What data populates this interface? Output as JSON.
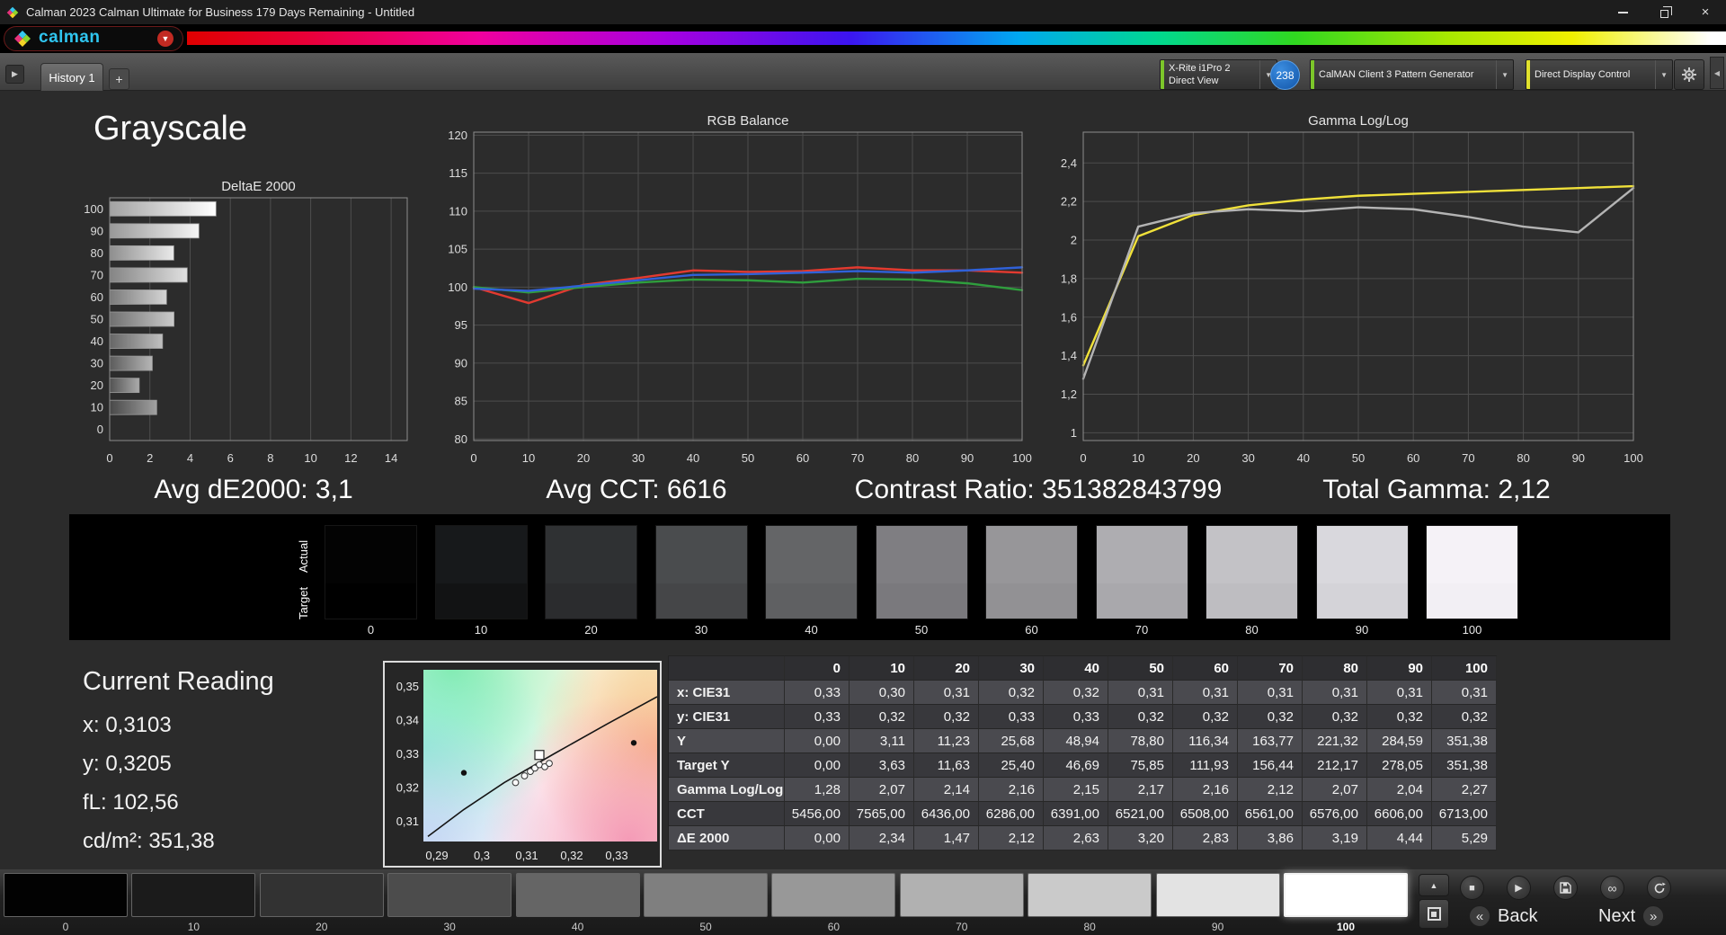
{
  "window": {
    "title": "Calman 2023 Calman Ultimate for Business 179 Days Remaining  - Untitled"
  },
  "brand": {
    "logo_text": "calman"
  },
  "tabs": {
    "history": "History 1",
    "add": "+"
  },
  "toolbar": {
    "meter_line1": "X-Rite i1Pro 2",
    "meter_line2": "Direct View",
    "meter_badge": "238",
    "pattern_generator": "CalMAN Client 3 Pattern Generator",
    "display_control": "Direct Display Control",
    "accent_green": "#7cc62a",
    "accent_yellow": "#e2e22e",
    "badge_blue": "#1b6ec2"
  },
  "page_title": "Grayscale",
  "stats": {
    "avg_de2000": "Avg dE2000: 3,1",
    "avg_cct": "Avg CCT: 6616",
    "contrast_ratio": "Contrast Ratio: 351382843799",
    "total_gamma": "Total Gamma: 2,12"
  },
  "chart_data": [
    {
      "id": "deltae",
      "type": "bar",
      "title": "DeltaE 2000",
      "orientation": "horizontal",
      "categories": [
        100,
        90,
        80,
        70,
        60,
        50,
        40,
        30,
        20,
        10,
        0
      ],
      "values": [
        5.29,
        4.44,
        3.19,
        3.86,
        2.83,
        3.2,
        2.63,
        2.12,
        1.47,
        2.34,
        0
      ],
      "xlim": [
        0,
        14.8
      ],
      "xticks": [
        0,
        2,
        4,
        6,
        8,
        10,
        12,
        14
      ]
    },
    {
      "id": "rgb-balance",
      "type": "line",
      "title": "RGB Balance",
      "x": [
        0,
        10,
        20,
        30,
        40,
        50,
        60,
        70,
        80,
        90,
        100
      ],
      "xticks": [
        0,
        10,
        20,
        30,
        40,
        50,
        60,
        70,
        80,
        90,
        100
      ],
      "xlim": [
        0,
        100
      ],
      "ylim": [
        79.8,
        120.4
      ],
      "yticks": [
        120,
        115,
        110,
        105,
        100,
        95,
        90,
        85,
        80
      ],
      "series": [
        {
          "name": "Red",
          "color": "#e23a30",
          "values": [
            100,
            97.9,
            100.3,
            101.2,
            102.2,
            102.0,
            102.1,
            102.6,
            102.2,
            102.2,
            101.9
          ]
        },
        {
          "name": "Green",
          "color": "#2f9e3d",
          "values": [
            100,
            99.3,
            100.0,
            100.6,
            101.0,
            100.9,
            100.6,
            101.1,
            101.0,
            100.5,
            99.6
          ]
        },
        {
          "name": "Blue",
          "color": "#3061d8",
          "values": [
            99.8,
            99.5,
            100.2,
            100.9,
            101.6,
            101.7,
            101.9,
            102.1,
            101.9,
            102.2,
            102.6
          ]
        }
      ]
    },
    {
      "id": "gamma",
      "type": "line",
      "title": "Gamma Log/Log",
      "x": [
        0,
        10,
        20,
        30,
        40,
        50,
        60,
        70,
        80,
        90,
        100
      ],
      "xticks": [
        0,
        10,
        20,
        30,
        40,
        50,
        60,
        70,
        80,
        90,
        100
      ],
      "xlim": [
        0,
        100
      ],
      "ylim": [
        0.96,
        2.56
      ],
      "yticks": [
        2.4,
        2.2,
        2.0,
        1.8,
        1.6,
        1.4,
        1.2,
        1.0
      ],
      "ytick_labels": [
        "2,4",
        "2,2",
        "2",
        "1,8",
        "1,6",
        "1,4",
        "1,2",
        "1"
      ],
      "series": [
        {
          "name": "Target",
          "color": "#f0e13a",
          "values": [
            1.35,
            2.02,
            2.13,
            2.18,
            2.21,
            2.23,
            2.24,
            2.25,
            2.26,
            2.27,
            2.28
          ]
        },
        {
          "name": "Measured",
          "color": "#b4b4b4",
          "values": [
            1.28,
            2.07,
            2.14,
            2.16,
            2.15,
            2.17,
            2.16,
            2.12,
            2.07,
            2.04,
            2.27
          ]
        }
      ]
    },
    {
      "id": "cie",
      "type": "scatter",
      "title": "CIE chromaticity detail",
      "xlim": [
        0.287,
        0.339
      ],
      "ylim": [
        0.304,
        0.355
      ],
      "xticks": [
        0.29,
        0.3,
        0.31,
        0.32,
        0.33
      ],
      "xtick_labels": [
        "0,29",
        "0,3",
        "0,31",
        "0,32",
        "0,33"
      ],
      "yticks": [
        0.35,
        0.34,
        0.33,
        0.32,
        0.31
      ],
      "ytick_labels": [
        "0,35",
        "0,34",
        "0,33",
        "0,32",
        "0,31"
      ],
      "locus": [
        [
          0.288,
          0.3055
        ],
        [
          0.296,
          0.3135
        ],
        [
          0.305,
          0.3215
        ],
        [
          0.316,
          0.33
        ],
        [
          0.328,
          0.339
        ],
        [
          0.339,
          0.347
        ]
      ],
      "measured_points": [
        [
          0.3075,
          0.3215
        ],
        [
          0.3095,
          0.3235
        ],
        [
          0.3108,
          0.3248
        ],
        [
          0.3118,
          0.3258
        ],
        [
          0.3128,
          0.3268
        ],
        [
          0.314,
          0.3262
        ],
        [
          0.315,
          0.3272
        ]
      ],
      "target_point": [
        0.3128,
        0.3297
      ],
      "reference_points": [
        [
          0.296,
          0.3244
        ],
        [
          0.3338,
          0.3333
        ]
      ]
    }
  ],
  "swatch_strip": {
    "actual_label": "Actual",
    "target_label": "Target",
    "levels": [
      "0",
      "10",
      "20",
      "30",
      "40",
      "50",
      "60",
      "70",
      "80",
      "90",
      "100"
    ],
    "actual_colors": [
      "#030303",
      "#17191b",
      "#2f3133",
      "#4a4c4e",
      "#646567",
      "#7f7e82",
      "#979699",
      "#aeadb1",
      "#c3c2c6",
      "#d9d8dd",
      "#f5f2f7"
    ],
    "target_colors": [
      "#000000",
      "#121314",
      "#2b2c2e",
      "#454648",
      "#5f6062",
      "#7a797d",
      "#929194",
      "#a9a8ac",
      "#bebdc1",
      "#d4d3d8",
      "#f2eff4"
    ]
  },
  "current_reading": {
    "title": "Current Reading",
    "x": "x: 0,3103",
    "y": "y: 0,3205",
    "fl": "fL: 102,56",
    "cdm2": "cd/m²: 351,38"
  },
  "table": {
    "columns": [
      "0",
      "10",
      "20",
      "30",
      "40",
      "50",
      "60",
      "70",
      "80",
      "90",
      "100"
    ],
    "rows": [
      {
        "label": "x: CIE31",
        "values": [
          "0,33",
          "0,30",
          "0,31",
          "0,32",
          "0,32",
          "0,31",
          "0,31",
          "0,31",
          "0,31",
          "0,31",
          "0,31"
        ]
      },
      {
        "label": "y: CIE31",
        "values": [
          "0,33",
          "0,32",
          "0,32",
          "0,33",
          "0,33",
          "0,32",
          "0,32",
          "0,32",
          "0,32",
          "0,32",
          "0,32"
        ]
      },
      {
        "label": "Y",
        "values": [
          "0,00",
          "3,11",
          "11,23",
          "25,68",
          "48,94",
          "78,80",
          "116,34",
          "163,77",
          "221,32",
          "284,59",
          "351,38"
        ]
      },
      {
        "label": "Target Y",
        "values": [
          "0,00",
          "3,63",
          "11,63",
          "25,40",
          "46,69",
          "75,85",
          "111,93",
          "156,44",
          "212,17",
          "278,05",
          "351,38"
        ]
      },
      {
        "label": "Gamma Log/Log",
        "values": [
          "1,28",
          "2,07",
          "2,14",
          "2,16",
          "2,15",
          "2,17",
          "2,16",
          "2,12",
          "2,07",
          "2,04",
          "2,27"
        ]
      },
      {
        "label": "CCT",
        "values": [
          "5456,00",
          "7565,00",
          "6436,00",
          "6286,00",
          "6391,00",
          "6521,00",
          "6508,00",
          "6561,00",
          "6576,00",
          "6606,00",
          "6713,00"
        ]
      },
      {
        "label": "ΔE 2000",
        "values": [
          "0,00",
          "2,34",
          "1,47",
          "2,12",
          "2,63",
          "3,20",
          "2,83",
          "3,86",
          "3,19",
          "4,44",
          "5,29"
        ]
      }
    ]
  },
  "bottom_bar": {
    "patch_labels": [
      "0",
      "10",
      "20",
      "30",
      "40",
      "50",
      "60",
      "70",
      "80",
      "90",
      "100"
    ],
    "patch_colors": [
      "#020202",
      "#1b1b1b",
      "#323232",
      "#4c4c4c",
      "#656565",
      "#7f7f7f",
      "#989898",
      "#b1b1b1",
      "#cacaca",
      "#e3e3e3",
      "#ffffff"
    ],
    "selected_index": 10,
    "back_label": "Back",
    "next_label": "Next"
  }
}
